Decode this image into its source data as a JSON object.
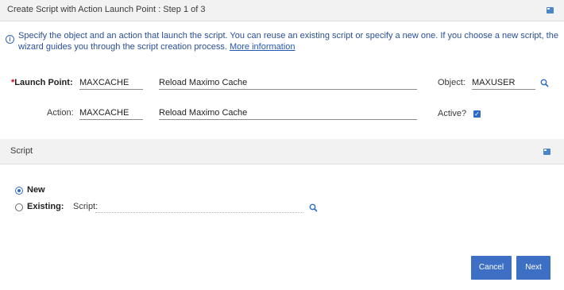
{
  "dialog": {
    "title": "Create Script with Action Launch Point : Step 1 of 3",
    "info_text": "Specify the object and an action that launch the script. You can reuse an existing script or specify a new one. If you choose a new script, the wizard guides you through the script creation process.",
    "info_link": "More information"
  },
  "form": {
    "launch_point_required": "*",
    "launch_point_label": "Launch Point:",
    "launch_point_value": "MAXCACHE",
    "launch_point_description": "Reload Maximo Cache",
    "object_label": "Object:",
    "object_value": "MAXUSER",
    "action_label": "Action:",
    "action_value": "MAXCACHE",
    "action_description": "Reload Maximo Cache",
    "active_label": "Active?",
    "active_checked": true
  },
  "script_section": {
    "title": "Script",
    "option_new": "New",
    "option_existing": "Existing:",
    "script_label": "Script:",
    "script_value": "",
    "selected_option": "new"
  },
  "buttons": {
    "cancel": "Cancel",
    "next": "Next"
  },
  "colors": {
    "accent": "#3d6fc4",
    "info_text": "#2a4f96",
    "header_bg": "#f2f2f2"
  }
}
